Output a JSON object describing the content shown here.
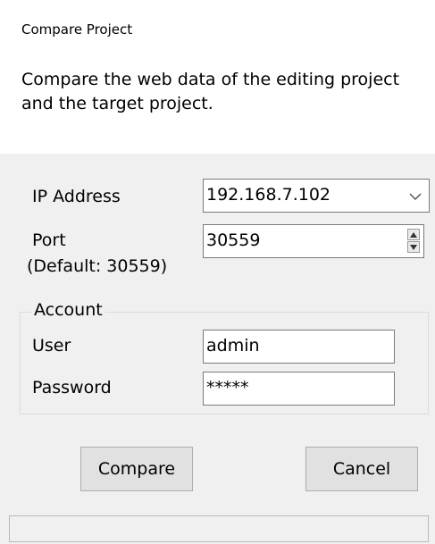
{
  "dialog": {
    "title": "Compare Project",
    "description": "Compare the web data of the editing project and the target project."
  },
  "connection": {
    "ip_label": "IP Address",
    "ip_value": "192.168.7.102",
    "port_label": "Port",
    "port_hint": "(Default: 30559)",
    "port_value": "30559"
  },
  "account": {
    "group_label": "Account",
    "user_label": "User",
    "user_value": "admin",
    "password_label": "Password",
    "password_value": "*****"
  },
  "buttons": {
    "compare": "Compare",
    "cancel": "Cancel"
  },
  "icons": {
    "dropdown": "chevron-down-icon",
    "spin_up": "triangle-up-icon",
    "spin_down": "triangle-down-icon"
  }
}
